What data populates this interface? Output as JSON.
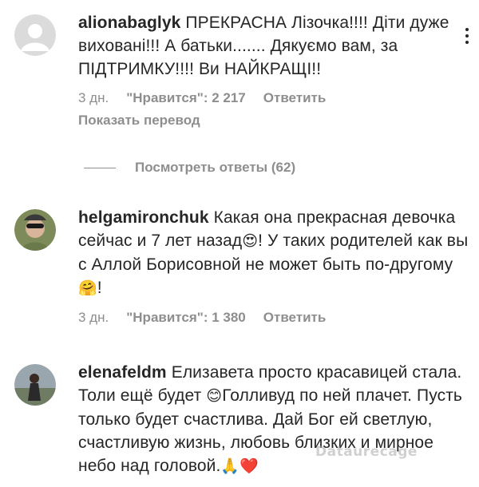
{
  "comments": [
    {
      "username": "alionabaglyk",
      "text": "ПРЕКРАСНА Лізочка!!!! Діти дуже виховані!!! А батьки....... Дякуємо вам, за ПІДТРИМКУ!!!! Ви НАЙКРАЩІ!!",
      "time": "3 дн.",
      "likes": "\"Нравится\": 2 217",
      "reply": "Ответить",
      "translate": "Показать перевод",
      "avatar": "default-avatar-icon"
    },
    {
      "username": "helgamironchuk",
      "text": "Какая она прекрасная девочка сейчас и 7 лет назад",
      "text_emoji_1": "😍",
      "text_2": "! У таких родителей как вы с Аллой Борисовной не может быть по-другому ",
      "text_emoji_2": "🤗",
      "text_3": "!",
      "time": "3 дн.",
      "likes": "\"Нравится\": 1 380",
      "reply": "Ответить",
      "avatar": "user-photo-avatar"
    },
    {
      "username": "elenafeldm",
      "text": "Елизавета просто красавицей стала. Толи ещё будет ",
      "text_emoji_1": "😊",
      "text_2": "Голливуд по ней плачет. Пусть только будет счастлива. Дай Бог ей светлую, счастливую жизнь, любовь близких и мирное небо над головой.",
      "text_emoji_2": "🙏❤️",
      "avatar": "user-photo-avatar"
    }
  ],
  "view_replies": "Посмотреть ответы (62)",
  "watermark": "Dataurecage"
}
